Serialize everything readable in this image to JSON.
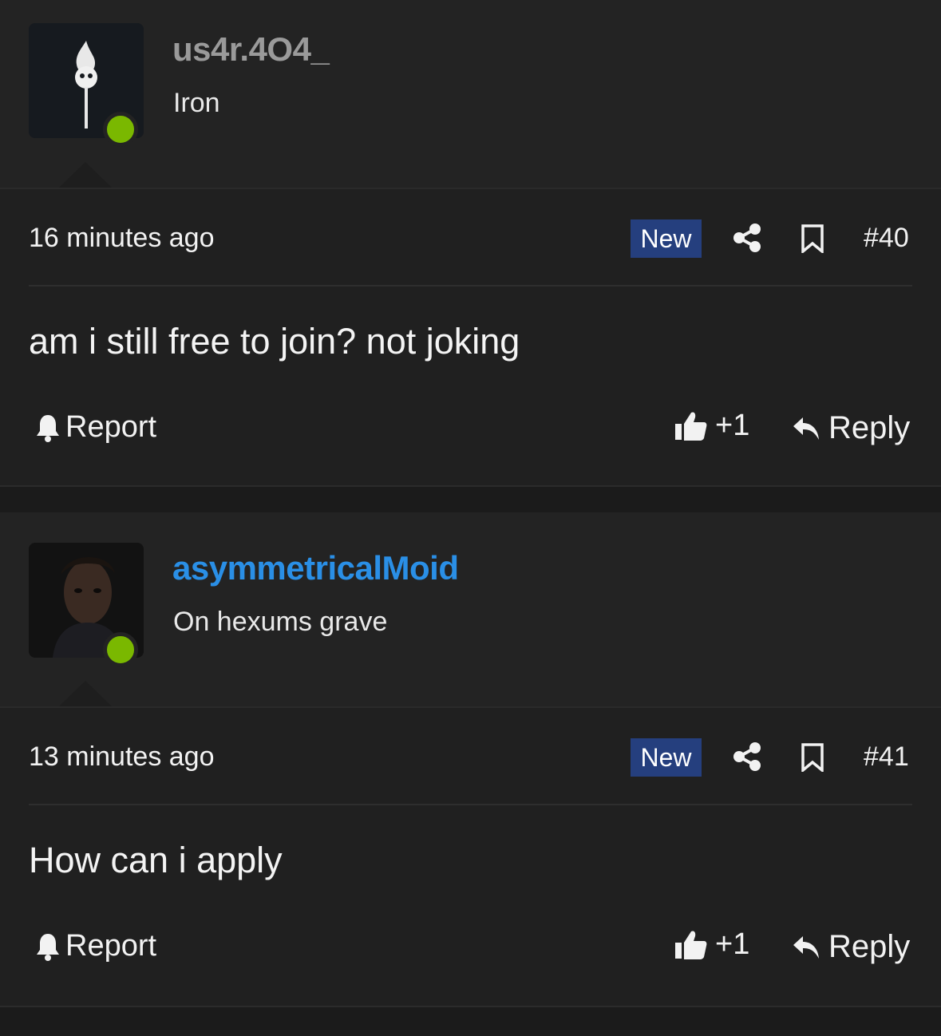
{
  "posts": [
    {
      "username": "us4r.4O4_",
      "username_color": "#9a9a9a",
      "rank": "Iron",
      "time": "16 minutes ago",
      "badge": "New",
      "post_number": "#40",
      "message": "am i still free to join? not joking",
      "report_label": "Report",
      "like_label": "+1",
      "reply_label": "Reply"
    },
    {
      "username": "asymmetricalMoid",
      "username_color": "#2a8fe6",
      "rank": "On hexums grave",
      "time": "13 minutes ago",
      "badge": "New",
      "post_number": "#41",
      "message": "How can i apply",
      "report_label": "Report",
      "like_label": "+1",
      "reply_label": "Reply"
    }
  ],
  "colors": {
    "online": "#7ab800",
    "badge_bg": "#253f7e",
    "background": "#232323"
  },
  "icons": [
    "bell-icon",
    "thumbs-up-icon",
    "reply-arrow-icon",
    "share-icon",
    "bookmark-icon"
  ]
}
